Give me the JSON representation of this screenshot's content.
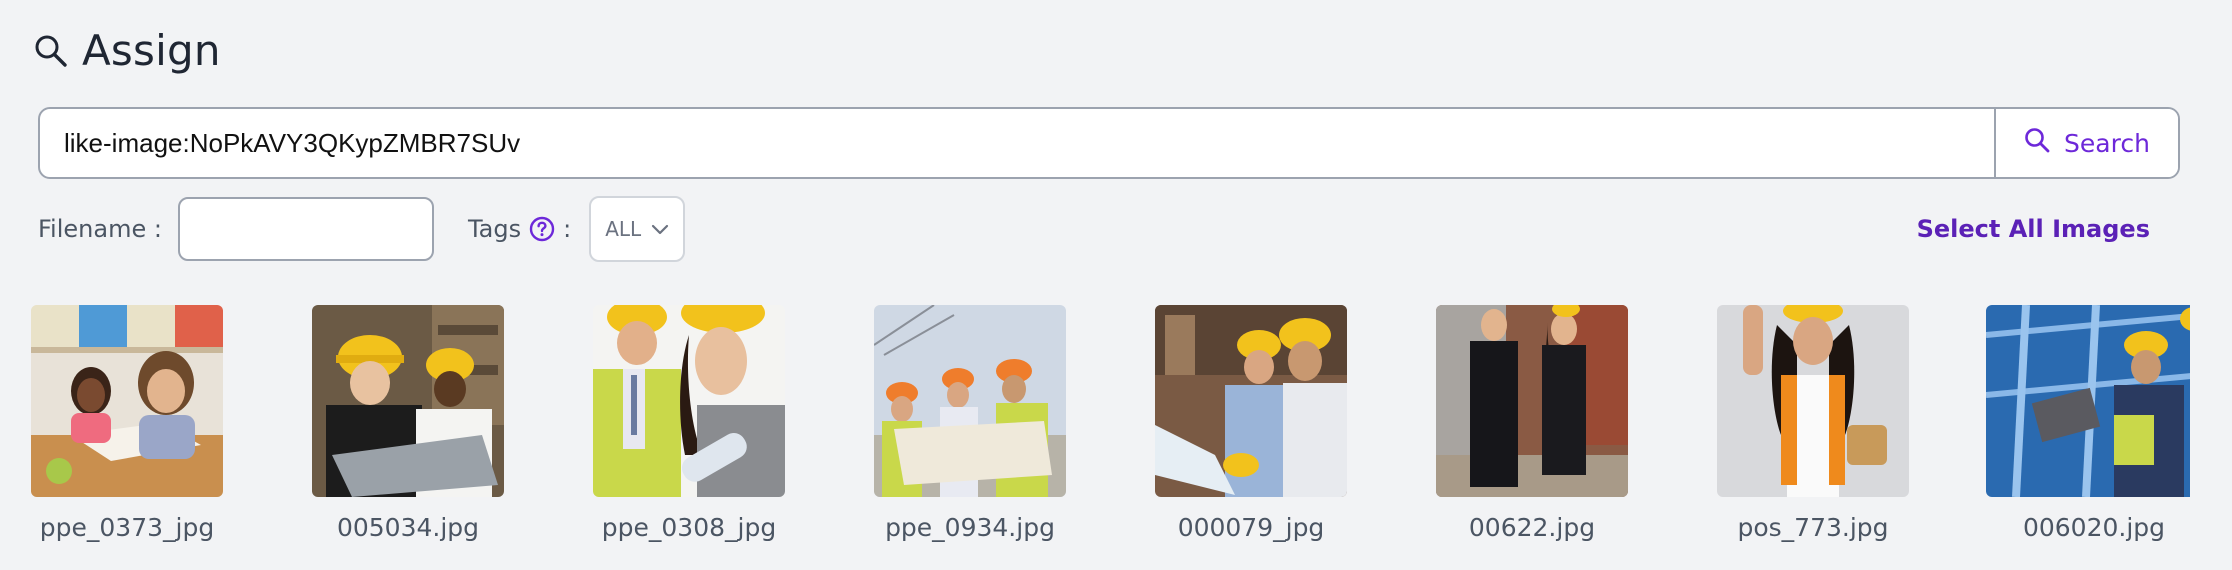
{
  "header": {
    "title": "Assign",
    "icon": "search-icon"
  },
  "search": {
    "query": "like-image:NoPkAVY3QKypZMBR7SUv",
    "button_label": "Search",
    "button_icon": "search-icon"
  },
  "filters": {
    "filename_label": "Filename :",
    "filename_value": "",
    "tags_label": "Tags",
    "tags_colon": ":",
    "tags_help_icon": "question-circle-icon",
    "tags_selected": "ALL",
    "select_all_label": "Select All Images"
  },
  "colors": {
    "accent": "#6d28d9",
    "background": "#f2f3f5",
    "border": "#9ca3af"
  },
  "images": [
    {
      "filename": "ppe_0373_jpg",
      "alt": "children studying at desk"
    },
    {
      "filename": "005034.jpg",
      "alt": "workers in hard hats with blueprint"
    },
    {
      "filename": "ppe_0308_jpg",
      "alt": "smiling workers in hard hats"
    },
    {
      "filename": "ppe_0934.jpg",
      "alt": "engineers reading plans on site"
    },
    {
      "filename": "000079_jpg",
      "alt": "workers reviewing plans"
    },
    {
      "filename": "00622.jpg",
      "alt": "business people on construction site"
    },
    {
      "filename": "pos_773.jpg",
      "alt": "woman in safety vest and hard hat"
    },
    {
      "filename": "006020.jpg",
      "alt": "workers with clipboard in blue structure"
    }
  ]
}
